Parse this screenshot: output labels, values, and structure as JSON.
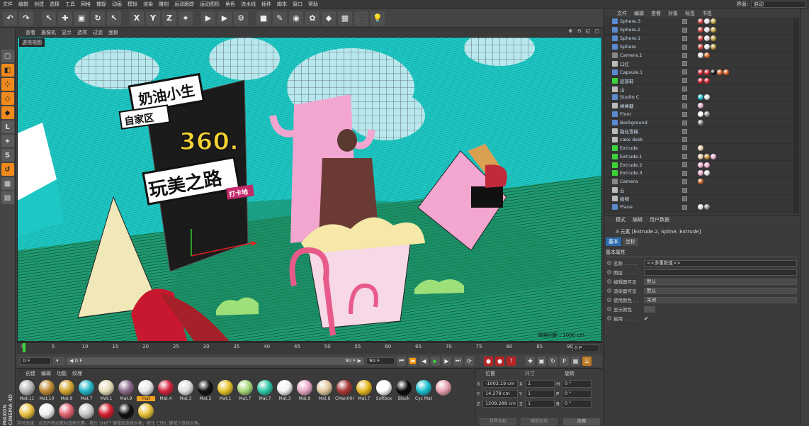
{
  "menubar": {
    "items": [
      "文件",
      "编辑",
      "创建",
      "选择",
      "工具",
      "网格",
      "捕捉",
      "动画",
      "模拟",
      "渲染",
      "雕刻",
      "运动跟踪",
      "运动图形",
      "角色",
      "流水线",
      "插件",
      "脚本",
      "窗口",
      "帮助"
    ],
    "layout_label": "界面:",
    "layout_value": "启动"
  },
  "toolbar": {
    "buttons": [
      {
        "name": "undo-icon",
        "glyph": "↶"
      },
      {
        "name": "redo-icon",
        "glyph": "↷"
      },
      {
        "name": "select-icon",
        "glyph": "↖"
      },
      {
        "name": "move-icon",
        "glyph": "✚"
      },
      {
        "name": "scale-icon",
        "glyph": "▣"
      },
      {
        "name": "rotate-icon",
        "glyph": "↻"
      },
      {
        "name": "last-tool-icon",
        "glyph": "↖"
      },
      {
        "name": "x-axis-icon",
        "glyph": "X"
      },
      {
        "name": "y-axis-icon",
        "glyph": "Y"
      },
      {
        "name": "z-axis-icon",
        "glyph": "Z"
      },
      {
        "name": "coord-system-icon",
        "glyph": "⌖"
      },
      {
        "name": "render-view-icon",
        "glyph": "▶"
      },
      {
        "name": "render-picture-icon",
        "glyph": "▶"
      },
      {
        "name": "render-settings-icon",
        "glyph": "⚙"
      },
      {
        "name": "cube-icon",
        "glyph": "■"
      },
      {
        "name": "spline-icon",
        "glyph": "✎"
      },
      {
        "name": "nurbs-icon",
        "glyph": "◉"
      },
      {
        "name": "array-icon",
        "glyph": "✿"
      },
      {
        "name": "deformer-icon",
        "glyph": "◆"
      },
      {
        "name": "scene-icon",
        "glyph": "▦"
      },
      {
        "name": "camera-icon",
        "glyph": "🎥"
      },
      {
        "name": "light-icon",
        "glyph": "💡"
      }
    ]
  },
  "viewport": {
    "menu": [
      "查看",
      "摄像机",
      "显示",
      "选项",
      "过滤",
      "面板"
    ],
    "controls": "✥ ⟲ ◱ ▢",
    "view_label": "透视视图",
    "grid_label": "网格间距 : 1000 cm",
    "signs": {
      "line1": "奶油小生",
      "line2": "自家区",
      "big": "360.",
      "road": "玩美之路",
      "tag": "打卡地"
    }
  },
  "timeline": {
    "ticks": [
      "0",
      "5",
      "10",
      "15",
      "20",
      "25",
      "30",
      "35",
      "40",
      "45",
      "50",
      "55",
      "60",
      "65",
      "70",
      "75",
      "80",
      "85",
      "90"
    ],
    "current": "0 F"
  },
  "playbar": {
    "start": "0 F",
    "range_left": "◀ 0 F",
    "range_right": "90 F ▶",
    "end": "90 F"
  },
  "materials": {
    "menu": [
      "创建",
      "编辑",
      "功能",
      "纹理"
    ],
    "items": [
      {
        "name": "Mat.11",
        "color": "#b8b8b8"
      },
      {
        "name": "Mat.10",
        "color": "#c08b35"
      },
      {
        "name": "Mat.9",
        "color": "#d4a530"
      },
      {
        "name": "Mat.7",
        "color": "#23b8c8"
      },
      {
        "name": "Mat.1",
        "color": "#e6dcb8"
      },
      {
        "name": "Mat.9",
        "color": "#8a6a8a"
      },
      {
        "name": "mat",
        "color": "#e8e8e8",
        "selected": true
      },
      {
        "name": "Mat.4",
        "color": "#d4253f"
      },
      {
        "name": "Mat.3",
        "color": "#e0e0e0"
      },
      {
        "name": "Mat.2",
        "color": "#111111"
      },
      {
        "name": "Mat.1",
        "color": "#e5c22b"
      },
      {
        "name": "Mat.7",
        "color": "#a6d87a"
      },
      {
        "name": "Mat.7",
        "color": "#2dc8a8"
      },
      {
        "name": "Mat.3",
        "color": "#f2f2f2"
      },
      {
        "name": "Mat.8",
        "color": "#e8a8c8"
      },
      {
        "name": "Mat.8",
        "color": "#e4c8a0"
      },
      {
        "name": "CMan006",
        "color": "#a83838"
      },
      {
        "name": "Mat.7",
        "color": "#e8b820"
      },
      {
        "name": "Softbox",
        "color": "#ffffff"
      },
      {
        "name": "Black",
        "color": "#0a0a0a"
      },
      {
        "name": "Cyc Mat",
        "color": "#1cc0d0"
      }
    ],
    "row2": [
      "#e8a0b0",
      "#e8c040",
      "#f0f0f0",
      "#e06070",
      "#c8c8c8",
      "#d42030",
      "#101010",
      "#e8c038"
    ]
  },
  "coordinates": {
    "headers": [
      "位置",
      "尺寸",
      "旋转"
    ],
    "rows": [
      {
        "axis": "X",
        "pos": "-1003.19 cm",
        "size": "1",
        "rlabel": "H",
        "rot": "0 °"
      },
      {
        "axis": "Y",
        "pos": "14.278 cm",
        "size": "1",
        "rlabel": "P",
        "rot": "0 °"
      },
      {
        "axis": "Z",
        "pos": "1209.289 cm",
        "size": "1",
        "rlabel": "B",
        "rot": "0 °"
      }
    ],
    "mode1": "世界坐标",
    "mode2": "缩放比例",
    "apply": "应用"
  },
  "objects": {
    "menu": [
      "文件",
      "编辑",
      "查看",
      "对象",
      "标签",
      "书签"
    ],
    "rows": [
      {
        "name": "Sphere.3",
        "icon": "#5a8ad0",
        "tags": [
          "#d04040",
          "#e0e0e0",
          "#c0a040"
        ]
      },
      {
        "name": "Sphere.2",
        "icon": "#5a8ad0",
        "tags": [
          "#d04040",
          "#e0e0e0",
          "#c0a040"
        ]
      },
      {
        "name": "Sphere.1",
        "icon": "#5a8ad0",
        "tags": [
          "#d04040",
          "#e0e0e0",
          "#c0a040"
        ]
      },
      {
        "name": "Sphere",
        "icon": "#5a8ad0",
        "tags": [
          "#d04040",
          "#e0e0e0",
          "#c0a040"
        ]
      },
      {
        "name": "Camera.1",
        "icon": "#888888",
        "tags": [
          "#e0e0e0",
          "#d06020"
        ]
      },
      {
        "name": "口红",
        "icon": "#bbbbbb",
        "tags": []
      },
      {
        "name": "Capsule.1",
        "icon": "#5a8ad0",
        "tags": [
          "#d42030",
          "#d42030",
          "#111111",
          "#e06020",
          "#e06020"
        ]
      },
      {
        "name": "底部鞋",
        "icon": "#3ad43a",
        "tags": [
          "#d42030",
          "#d42030"
        ]
      },
      {
        "name": "山",
        "icon": "#bbbbbb",
        "tags": []
      },
      {
        "name": "Studio C",
        "icon": "#5a8ad0",
        "tags": [
          "#1cc0d0",
          "#e0e0e0"
        ]
      },
      {
        "name": "棒棒糖",
        "icon": "#bbbbbb",
        "tags": [
          "#e8a8c8"
        ]
      },
      {
        "name": "Floor",
        "icon": "#5a8ad0",
        "tags": [
          "#ffffff",
          "#888888"
        ]
      },
      {
        "name": "Background",
        "icon": "#5a8ad0",
        "tags": [
          "#888888"
        ]
      },
      {
        "name": "融化雪糕",
        "icon": "#bbbbbb",
        "tags": []
      },
      {
        "name": "cake desk",
        "icon": "#bbbbbb",
        "tags": []
      },
      {
        "name": "Extrude",
        "icon": "#3ad43a",
        "tags": [
          "#e4c8a0"
        ]
      },
      {
        "name": "Extrude.1",
        "icon": "#3ad43a",
        "tags": [
          "#e4c8a0",
          "#c08b35",
          "#e8a8c8"
        ]
      },
      {
        "name": "Extrude.2",
        "icon": "#3ad43a",
        "tags": [
          "#e8a8c8",
          "#e8a8c8"
        ]
      },
      {
        "name": "Extrude.3",
        "icon": "#3ad43a",
        "tags": [
          "#e8a8c8",
          "#e0e0e0"
        ]
      },
      {
        "name": "Camera",
        "icon": "#888888",
        "tags": [
          "#d06020"
        ]
      },
      {
        "name": "云",
        "icon": "#bbbbbb",
        "tags": []
      },
      {
        "name": "植物",
        "icon": "#bbbbbb",
        "tags": []
      },
      {
        "name": "Plane",
        "icon": "#5a8ad0",
        "tags": [
          "#e0e0e0",
          "#888888"
        ]
      }
    ]
  },
  "attributes": {
    "menu": [
      "模式",
      "编辑",
      "用户数据"
    ],
    "title": "3 元素 [Extrude.2, Spline, Extrude]",
    "tabs": [
      "基本",
      "坐标"
    ],
    "section": "基本属性",
    "fields": [
      {
        "label": "名称 . . . . .",
        "value": "<<多重数值>>",
        "type": "text"
      },
      {
        "label": "图层 . . . . .",
        "value": "",
        "type": "text"
      },
      {
        "label": "编辑器可见",
        "value": "默认",
        "type": "dd"
      },
      {
        "label": "渲染器可见",
        "value": "默认",
        "type": "dd"
      },
      {
        "label": "使用颜色 . .",
        "value": "关闭",
        "type": "dd"
      },
      {
        "label": "显示颜色",
        "value": "",
        "type": "swatch"
      },
      {
        "label": "启用 . . . . .",
        "value": "✔",
        "type": "check"
      }
    ]
  },
  "logo": "MAXON CINEMA 4D",
  "status": "实时选择：点击并拖动鼠标选择元素。按住 SHIFT 键增加选择对象；按住 CTRL 键减少选择对象。"
}
